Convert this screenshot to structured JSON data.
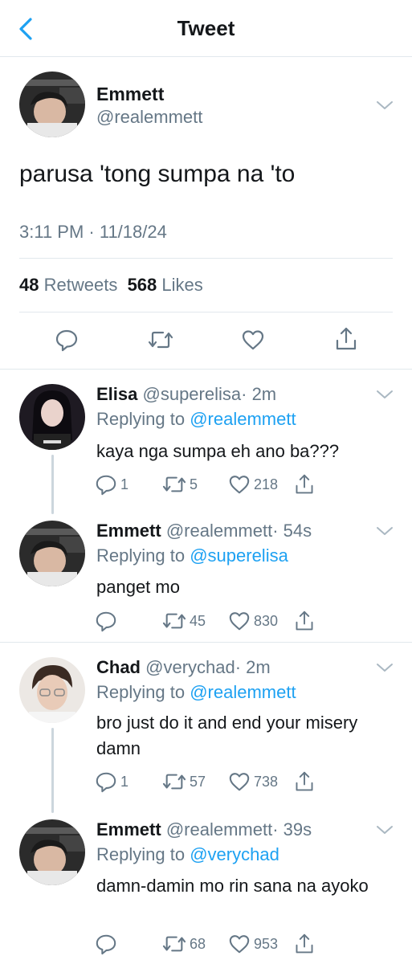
{
  "header": {
    "title": "Tweet",
    "back_icon": "chevron-left-icon"
  },
  "main_tweet": {
    "name": "Emmett",
    "handle": "@realemmett",
    "text": "parusa 'tong sumpa na 'to",
    "timestamp": "3:11 PM · 11/18/24",
    "retweets": "48",
    "retweets_label": "Retweets",
    "likes": "568",
    "likes_label": "Likes"
  },
  "replies": [
    {
      "name": "Elisa",
      "handle": "@superelisa",
      "time": "· 2m",
      "replying_label": "Replying to",
      "replying_to": "@realemmett",
      "text": "kaya nga sumpa eh ano ba???",
      "replies": "1",
      "retweets": "5",
      "likes": "218"
    },
    {
      "name": "Emmett",
      "handle": "@realemmett",
      "time": "· 54s",
      "replying_label": "Replying to",
      "replying_to": "@superelisa",
      "text": "panget mo",
      "replies": "",
      "retweets": "45",
      "likes": "830"
    },
    {
      "name": "Chad",
      "handle": "@verychad",
      "time": "· 2m",
      "replying_label": "Replying to",
      "replying_to": "@realemmett",
      "text": "bro just do it and end your misery damn",
      "replies": "1",
      "retweets": "57",
      "likes": "738"
    },
    {
      "name": "Emmett",
      "handle": "@realemmett",
      "time": "· 39s",
      "replying_label": "Replying to",
      "replying_to": "@verychad",
      "text": "damn-damin mo rin sana na ayoko",
      "replies": "",
      "retweets": "68",
      "likes": "953"
    }
  ],
  "colors": {
    "accent": "#1da1f2",
    "secondary_text": "#657786",
    "divider": "#e1e8ed"
  }
}
